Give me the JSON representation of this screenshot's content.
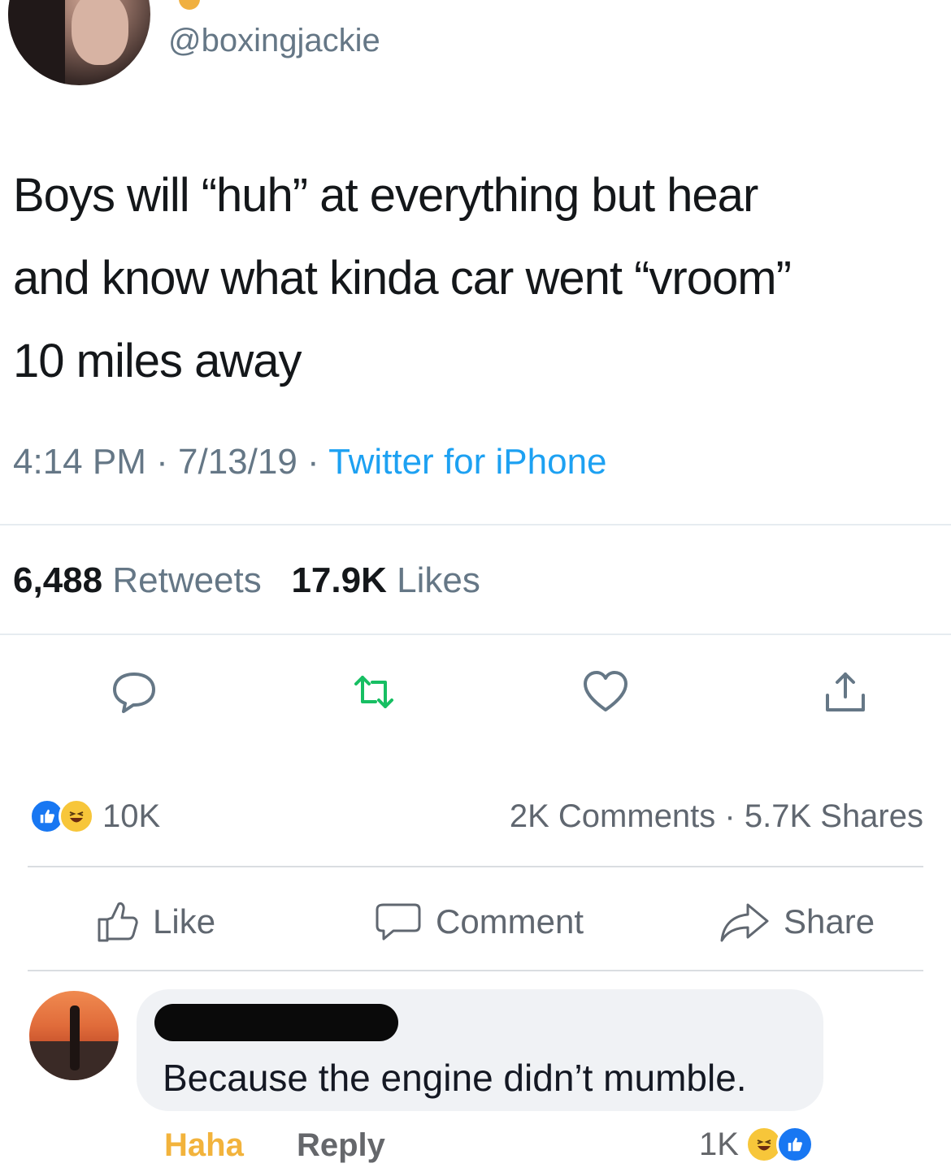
{
  "tweet": {
    "handle": "@boxingjackie",
    "text_line1": "Boys will “huh” at everything but hear",
    "text_line2": "and know what kinda car went “vroom”",
    "text_line3": "10 miles away",
    "time": "4:14 PM",
    "date": "7/13/19",
    "source": "Twitter for iPhone",
    "retweets_count": "6,488",
    "retweets_label": "Retweets",
    "likes_count": "17.9K",
    "likes_label": "Likes",
    "icons": [
      "reply-icon",
      "retweet-icon",
      "like-heart-icon",
      "share-icon"
    ],
    "colors": {
      "retweet_accent": "#17bf63",
      "source_link": "#1da1f2"
    }
  },
  "facebook": {
    "reactions_count": "10K",
    "comments": "2K Comments",
    "shares": "5.7K Shares",
    "actions": {
      "like": "Like",
      "comment": "Comment",
      "share": "Share"
    },
    "comment": {
      "text": "Because the engine didn’t mumble.",
      "reaction_label": "Haha",
      "reply_label": "Reply",
      "reaction_count": "1K"
    },
    "colors": {
      "like_blue": "#1877f2",
      "haha_yellow": "#f2b33c"
    }
  }
}
